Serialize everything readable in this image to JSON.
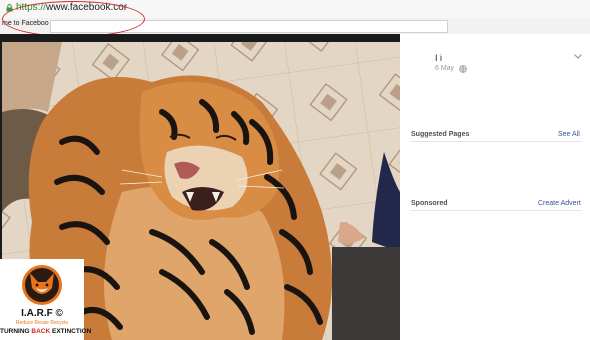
{
  "browser": {
    "url_scheme": "https://",
    "url_host": "www.facebook.cor",
    "tab_text": "me to Faceboo",
    "annotation_color": "#d42a2a"
  },
  "post": {
    "poster_name": "I       i",
    "date": "6 May",
    "privacy_icon": "globe-icon",
    "menu_icon": "chevron-down-icon"
  },
  "sidebar": {
    "suggested_title": "Suggested Pages",
    "suggested_link": "See All",
    "sponsored_title": "Sponsored",
    "sponsored_link": "Create Advert"
  },
  "logo": {
    "name": "I.A.R.F",
    "trademark": "©",
    "tagline": "Reduce Reuse Recycle",
    "slogan_start": "TURNING ",
    "slogan_highlight": "BACK",
    "slogan_end": " EXTINCTION",
    "accent_color": "#e6741e"
  },
  "colors": {
    "link": "#365899",
    "viewer_bg": "#1b1b1b"
  }
}
